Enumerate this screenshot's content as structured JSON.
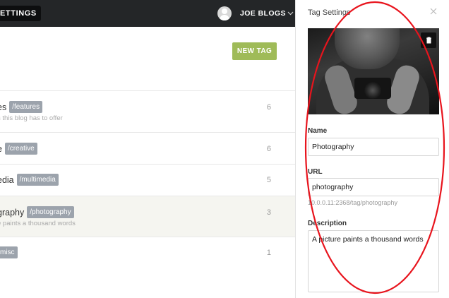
{
  "topbar": {
    "settings_label": "ETTINGS",
    "user_name": "JOE BLOGS",
    "user_menu_icon": "chevron-down-icon"
  },
  "main": {
    "new_tag_label": "NEW TAG",
    "tags": [
      {
        "name": "es",
        "slug": "/features",
        "description": "s this blog has to offer",
        "count": "6"
      },
      {
        "name": "e",
        "slug": "/creative",
        "description": "",
        "count": "6"
      },
      {
        "name": "edia",
        "slug": "/multimedia",
        "description": "",
        "count": "5"
      },
      {
        "name": "graphy",
        "slug": "/photography",
        "description": "e paints a thousand words",
        "count": "3"
      },
      {
        "name": "",
        "slug": "misc",
        "description": "",
        "count": "1"
      }
    ]
  },
  "panel": {
    "title": "Tag Settings",
    "close_icon": "close-icon",
    "image_delete_icon": "trash-icon",
    "name_label": "Name",
    "name_value": "Photography",
    "url_label": "URL",
    "url_value": "photography",
    "url_hint": "10.0.0.11:2368/tag/photography",
    "description_label": "Description",
    "description_value": "A picture paints a thousand words"
  },
  "colors": {
    "topbar_bg": "#242628",
    "new_tag_green": "#9fbb58",
    "slug_badge": "#9ca3ac",
    "selected_row": "#f5f5f0",
    "annotation_red": "#e8141d"
  }
}
